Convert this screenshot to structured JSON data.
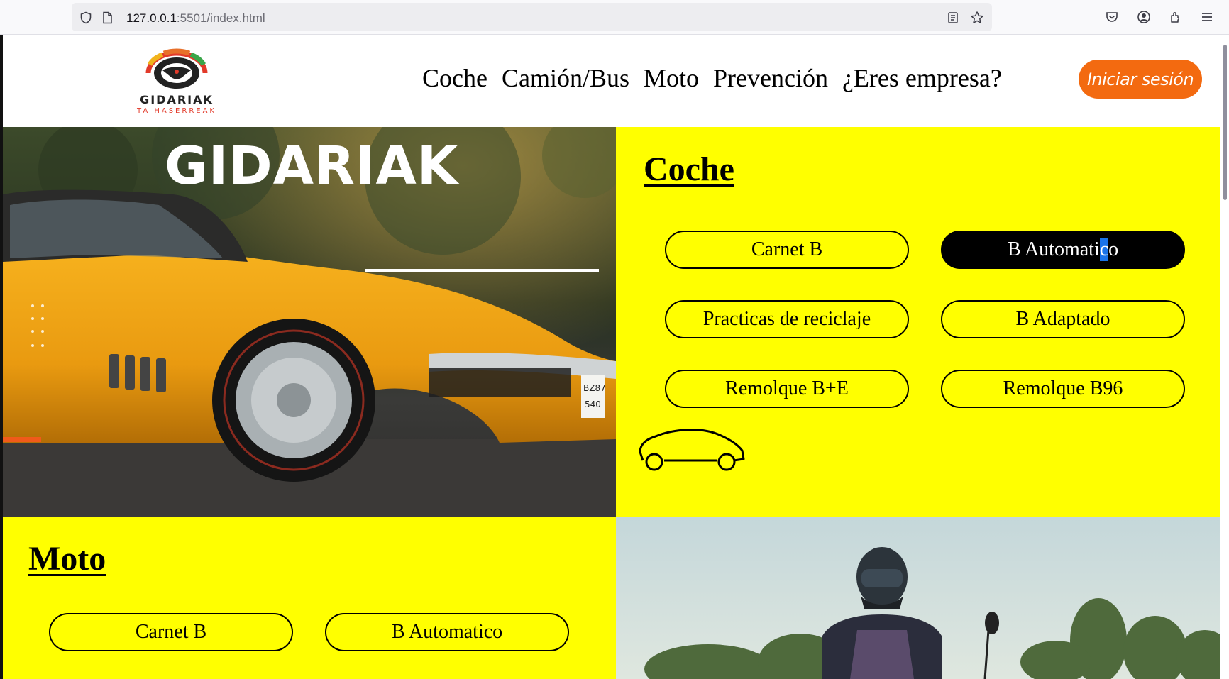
{
  "browser": {
    "url_host": "127.0.0.1",
    "url_rest": ":5501/index.html"
  },
  "header": {
    "logo": {
      "name": "GIDARIAK",
      "tagline": "TA HASERREAK"
    },
    "nav": [
      "Coche",
      "Camión/Bus",
      "Moto",
      "Prevención",
      "¿Eres empresa?"
    ],
    "login_label": "Iniciar sesión",
    "login_color": "#f36a10"
  },
  "hero": {
    "title": "GIDARIAK"
  },
  "coche": {
    "title": "Coche",
    "buttons": [
      {
        "label": "Carnet B",
        "active": false
      },
      {
        "label_before": "B Automati",
        "label_selected": "c",
        "label_after": "o",
        "active": true
      },
      {
        "label": "Practicas de reciclaje",
        "active": false
      },
      {
        "label": "B Adaptado",
        "active": false
      },
      {
        "label": "Remolque B+E",
        "active": false
      },
      {
        "label": "Remolque B96",
        "active": false
      }
    ],
    "icon": "car-outline-icon",
    "background": "#ffff00"
  },
  "moto": {
    "title": "Moto",
    "buttons": [
      {
        "label": "Carnet B"
      },
      {
        "label": "B Automatico"
      }
    ]
  }
}
